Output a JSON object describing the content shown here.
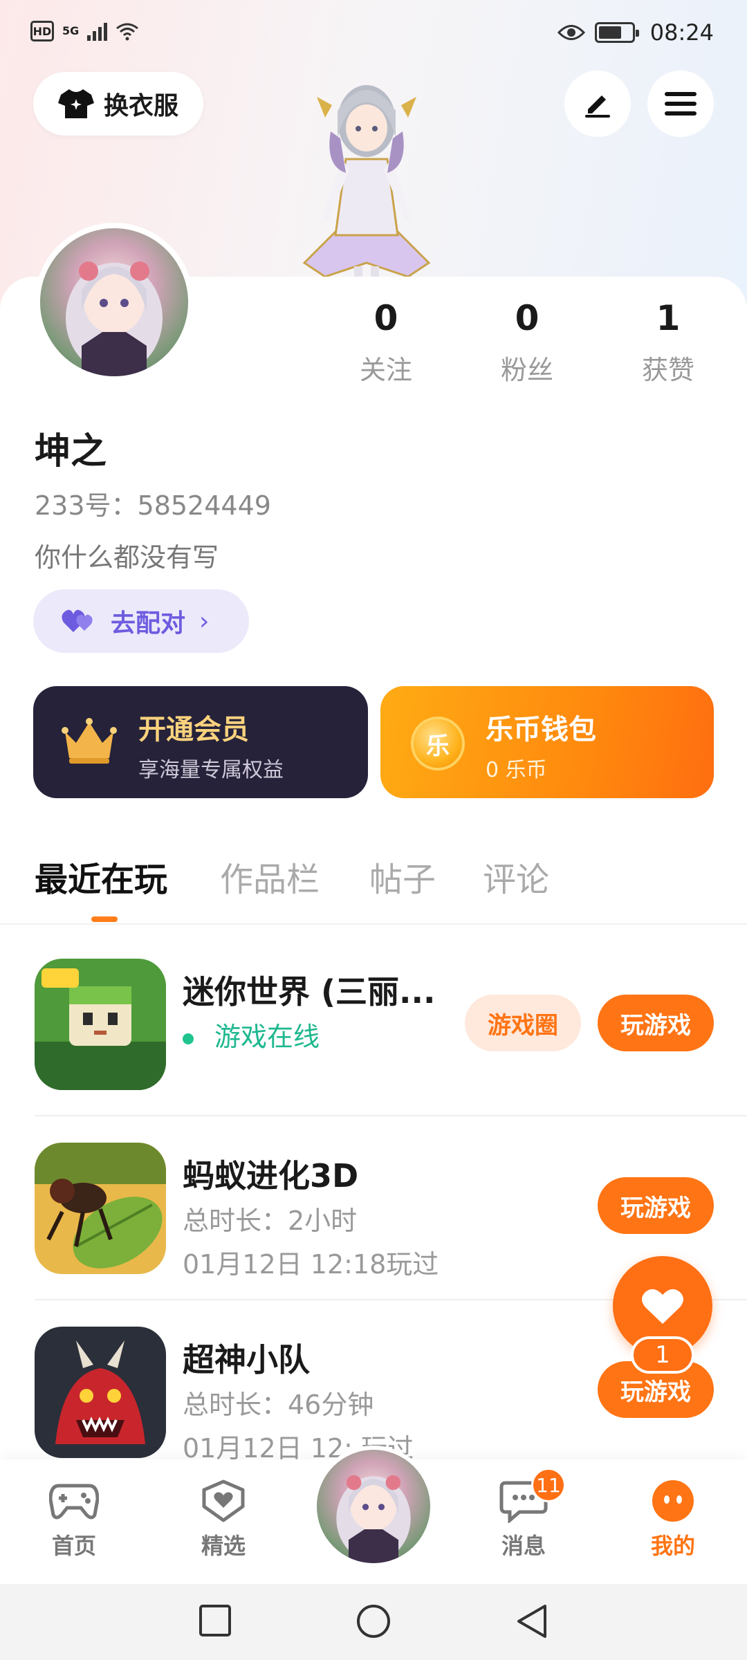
{
  "status_bar": {
    "left_badge": "HD",
    "signal": "5G",
    "time": "08:24"
  },
  "header": {
    "dress_button_label": "换衣服"
  },
  "profile": {
    "stats": [
      {
        "value": "0",
        "label": "关注"
      },
      {
        "value": "0",
        "label": "粉丝"
      },
      {
        "value": "1",
        "label": "获赞"
      }
    ],
    "name": "坤之",
    "account_id": "233号：58524449",
    "bio": "你什么都没有写",
    "match_label": "去配对"
  },
  "promos": {
    "vip": {
      "title": "开通会员",
      "subtitle": "享海量专属权益"
    },
    "wallet": {
      "title": "乐币钱包",
      "subtitle": "0 乐币",
      "coin_glyph": "乐"
    }
  },
  "tabs": [
    "最近在玩",
    "作品栏",
    "帖子",
    "评论"
  ],
  "games": [
    {
      "title": "迷你世界 (三丽...",
      "status": "游戏在线",
      "circle_label": "游戏圈",
      "play_label": "玩游戏"
    },
    {
      "title": "蚂蚁进化3D",
      "duration": "总时长：2小时",
      "last_played": "01月12日 12:18玩过",
      "play_label": "玩游戏"
    },
    {
      "title": "超神小队",
      "duration": "总时长：46分钟",
      "last_played": "01月12日 12:  玩过",
      "play_label": "玩游戏"
    }
  ],
  "like_fab": {
    "count": "1"
  },
  "bottom_nav": [
    {
      "label": "首页",
      "icon": "gamepad-icon"
    },
    {
      "label": "精选",
      "icon": "heart-badge-icon"
    },
    {
      "label": "消息",
      "icon": "chat-icon",
      "badge": "11"
    },
    {
      "label": "我的",
      "icon": "face-icon"
    }
  ],
  "colors": {
    "accent": "#ff7414",
    "vip_bg": "#25223a",
    "online": "#1fb88f",
    "match": "#6d5ce0"
  }
}
